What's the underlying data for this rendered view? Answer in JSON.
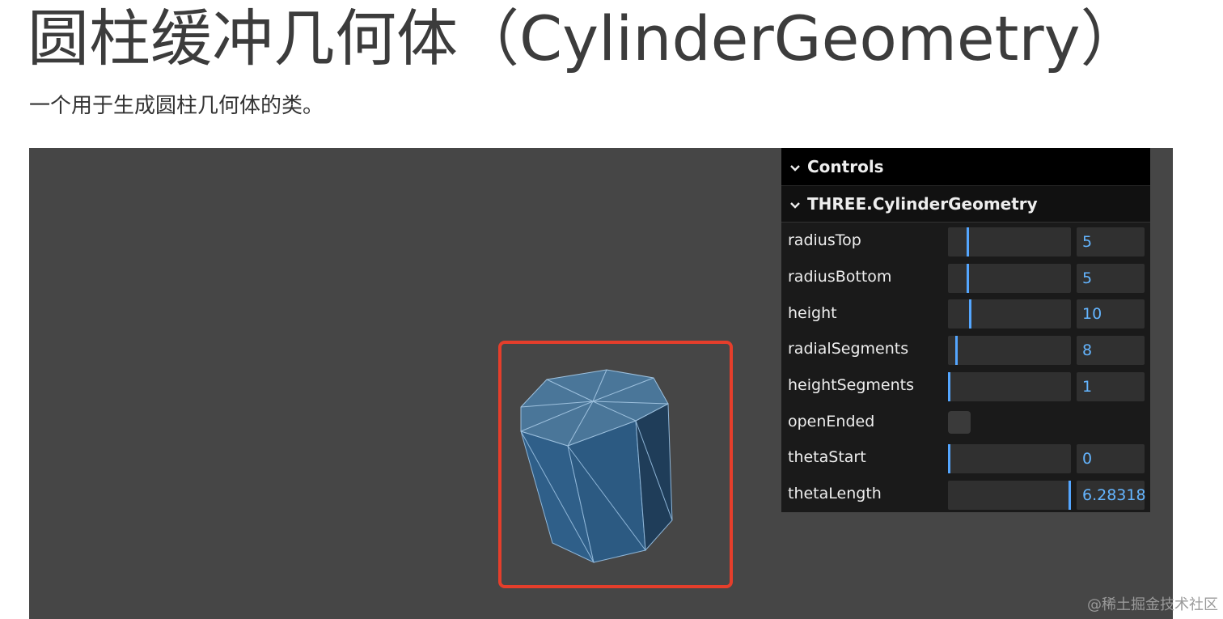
{
  "title": "圆柱缓冲几何体（CylinderGeometry）",
  "description": "一个用于生成圆柱几何体的类。",
  "gui": {
    "header": "Controls",
    "folder": "THREE.CylinderGeometry",
    "rows": [
      {
        "label": "radiusTop",
        "value": "5",
        "fill": 0.17
      },
      {
        "label": "radiusBottom",
        "value": "5",
        "fill": 0.17
      },
      {
        "label": "height",
        "value": "10",
        "fill": 0.19
      },
      {
        "label": "radialSegments",
        "value": "8",
        "fill": 0.08
      },
      {
        "label": "heightSegments",
        "value": "1",
        "fill": 0.0
      },
      {
        "label": "openEnded",
        "checked": false
      },
      {
        "label": "thetaStart",
        "value": "0",
        "fill": 0.0
      },
      {
        "label": "thetaLength",
        "value": "6.28318",
        "fill": 1.0
      }
    ]
  },
  "colors": {
    "viewport_bg": "#464646",
    "highlight": "#e53e2b",
    "slider_accent": "#54a6ff",
    "mesh": "#2f5a80"
  },
  "watermark": "@稀土掘金技术社区"
}
